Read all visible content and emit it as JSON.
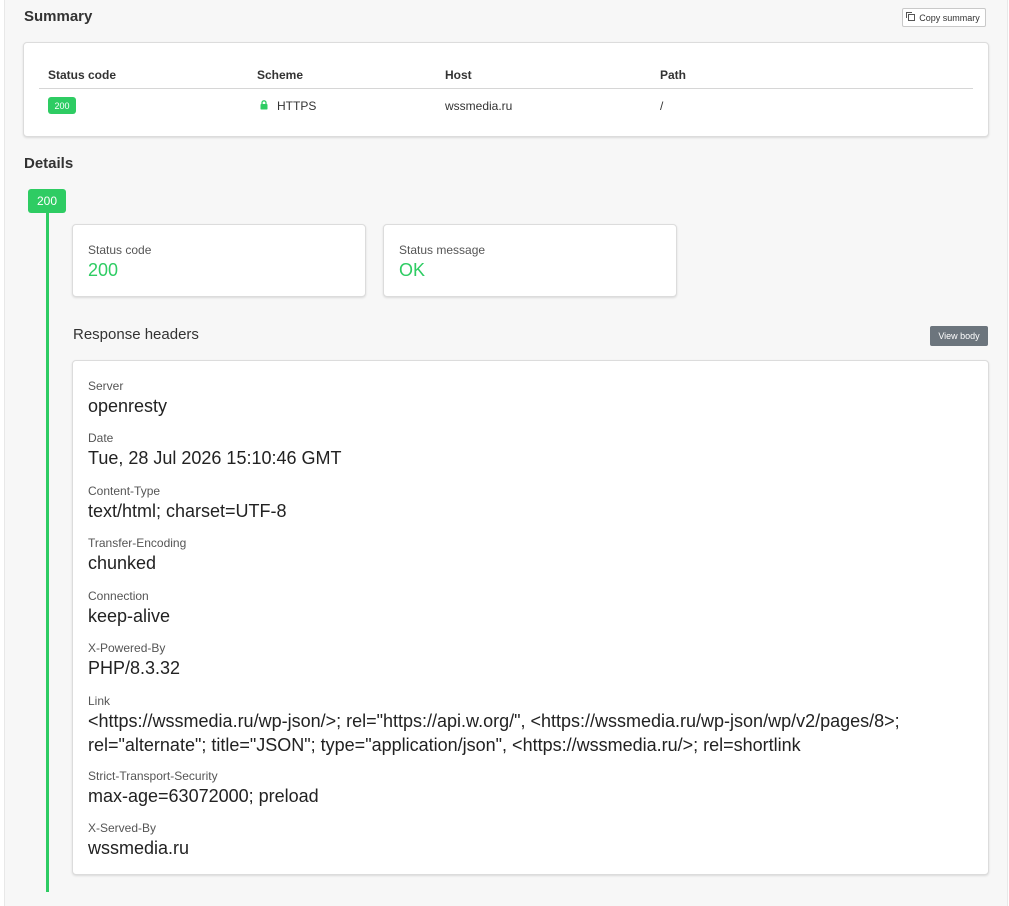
{
  "summary": {
    "title": "Summary",
    "copy_label": "Copy summary",
    "columns": [
      "Status code",
      "Scheme",
      "Host",
      "Path"
    ],
    "row": {
      "status": "200",
      "scheme": "HTTPS",
      "host": "wssmedia.ru",
      "path": "/"
    }
  },
  "details": {
    "title": "Details",
    "badge": "200",
    "status_code_label": "Status code",
    "status_code_value": "200",
    "status_message_label": "Status message",
    "status_message_value": "OK",
    "response_headers_title": "Response headers",
    "view_body_label": "View body",
    "headers": [
      {
        "name": "Server",
        "value": "openresty"
      },
      {
        "name": "Date",
        "value": "Tue, 28 Jul 2026 15:10:46 GMT"
      },
      {
        "name": "Content-Type",
        "value": "text/html; charset=UTF-8"
      },
      {
        "name": "Transfer-Encoding",
        "value": "chunked"
      },
      {
        "name": "Connection",
        "value": "keep-alive"
      },
      {
        "name": "X-Powered-By",
        "value": "PHP/8.3.32"
      },
      {
        "name": "Link",
        "value": "<https://wssmedia.ru/wp-json/>; rel=\"https://api.w.org/\", <https://wssmedia.ru/wp-json/wp/v2/pages/8>; rel=\"alternate\"; title=\"JSON\"; type=\"application/json\", <https://wssmedia.ru/>; rel=shortlink"
      },
      {
        "name": "Strict-Transport-Security",
        "value": "max-age=63072000; preload"
      },
      {
        "name": "X-Served-By",
        "value": "wssmedia.ru"
      }
    ]
  },
  "colors": {
    "success": "#2ecc63",
    "secondary_button": "#6c757d"
  },
  "icons": {
    "copy": "copy-icon",
    "lock": "lock-icon"
  }
}
